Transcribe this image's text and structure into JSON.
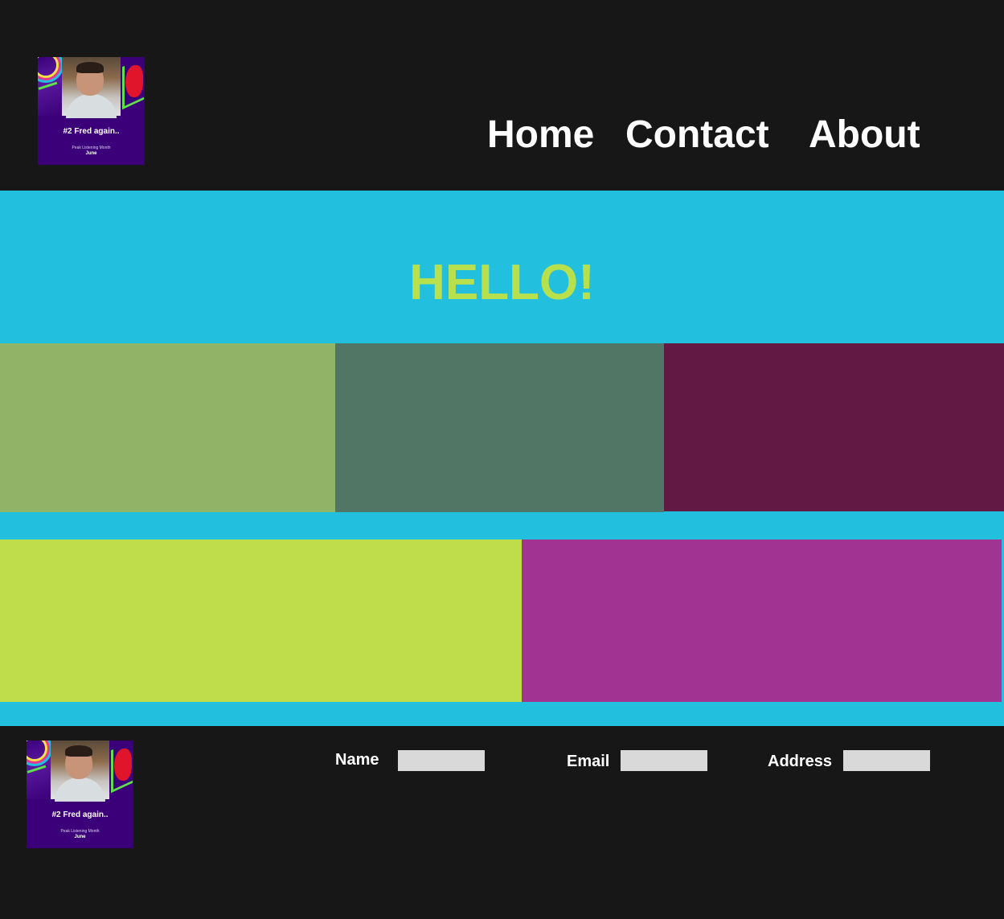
{
  "header": {
    "logo": {
      "rank_text": "#2 Fred again..",
      "sub_text": "Peak Listening Month",
      "month_text": "June"
    },
    "nav": [
      {
        "label": "Home"
      },
      {
        "label": "Contact"
      },
      {
        "label": "About"
      }
    ]
  },
  "hero": {
    "title": "HELLO!"
  },
  "colors": {
    "header_bg": "#181718",
    "page_bg": "#22bfdf",
    "hero_title": "#b8e04d",
    "block_row1": [
      "#90b368",
      "#527665",
      "#621a45"
    ],
    "block_row2": [
      "#bfdc4b",
      "#a13492"
    ]
  },
  "footer": {
    "logo": {
      "rank_text": "#2 Fred again..",
      "sub_text": "Peak Listening Month",
      "month_text": "June"
    },
    "fields": [
      {
        "label": "Name",
        "value": ""
      },
      {
        "label": "Email",
        "value": ""
      },
      {
        "label": "Address",
        "value": ""
      }
    ]
  }
}
